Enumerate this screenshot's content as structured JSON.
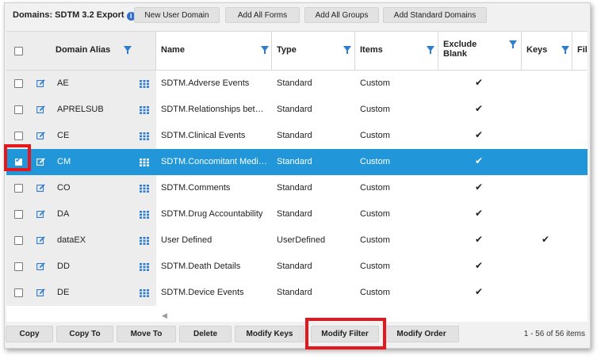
{
  "header": {
    "title": "Domains: SDTM 3.2 Export",
    "buttons": [
      "New User Domain",
      "Add All Forms",
      "Add All Groups",
      "Add Standard Domains"
    ]
  },
  "columns": {
    "alias": "Domain Alias",
    "name": "Name",
    "type": "Type",
    "items": "Items",
    "exclude_line1": "Exclude",
    "exclude_line2": "Blank",
    "keys": "Keys",
    "filter": "Fil"
  },
  "rows": [
    {
      "alias": "AE",
      "name": "SDTM.Adverse Events",
      "type": "Standard",
      "items": "Custom",
      "exclude": true,
      "keys": false,
      "selected": false
    },
    {
      "alias": "APRELSUB",
      "name": "SDTM.Relationships betw…",
      "type": "Standard",
      "items": "Custom",
      "exclude": true,
      "keys": false,
      "selected": false
    },
    {
      "alias": "CE",
      "name": "SDTM.Clinical Events",
      "type": "Standard",
      "items": "Custom",
      "exclude": true,
      "keys": false,
      "selected": false
    },
    {
      "alias": "CM",
      "name": "SDTM.Concomitant Medi…",
      "type": "Standard",
      "items": "Custom",
      "exclude": true,
      "keys": false,
      "selected": true
    },
    {
      "alias": "CO",
      "name": "SDTM.Comments",
      "type": "Standard",
      "items": "Custom",
      "exclude": true,
      "keys": false,
      "selected": false
    },
    {
      "alias": "DA",
      "name": "SDTM.Drug Accountability",
      "type": "Standard",
      "items": "Custom",
      "exclude": true,
      "keys": false,
      "selected": false
    },
    {
      "alias": "dataEX",
      "name": "User Defined",
      "type": "UserDefined",
      "items": "Custom",
      "exclude": true,
      "keys": true,
      "selected": false
    },
    {
      "alias": "DD",
      "name": "SDTM.Death Details",
      "type": "Standard",
      "items": "Custom",
      "exclude": true,
      "keys": false,
      "selected": false
    },
    {
      "alias": "DE",
      "name": "SDTM.Device Events",
      "type": "Standard",
      "items": "Custom",
      "exclude": true,
      "keys": false,
      "selected": false
    }
  ],
  "footer": {
    "buttons": [
      "Copy",
      "Copy To",
      "Move To",
      "Delete",
      "Modify Keys",
      "Modify Filter",
      "Modify Order"
    ],
    "count": "1 - 56 of 56 items"
  },
  "colors": {
    "selected_row": "#2196d9",
    "highlight": "#e5161c",
    "accent": "#2f7ccf"
  },
  "icons": {
    "info": "info-icon",
    "filter": "funnel-icon",
    "edit": "edit-icon",
    "grid": "grid-icon",
    "check": "checkmark-icon"
  }
}
